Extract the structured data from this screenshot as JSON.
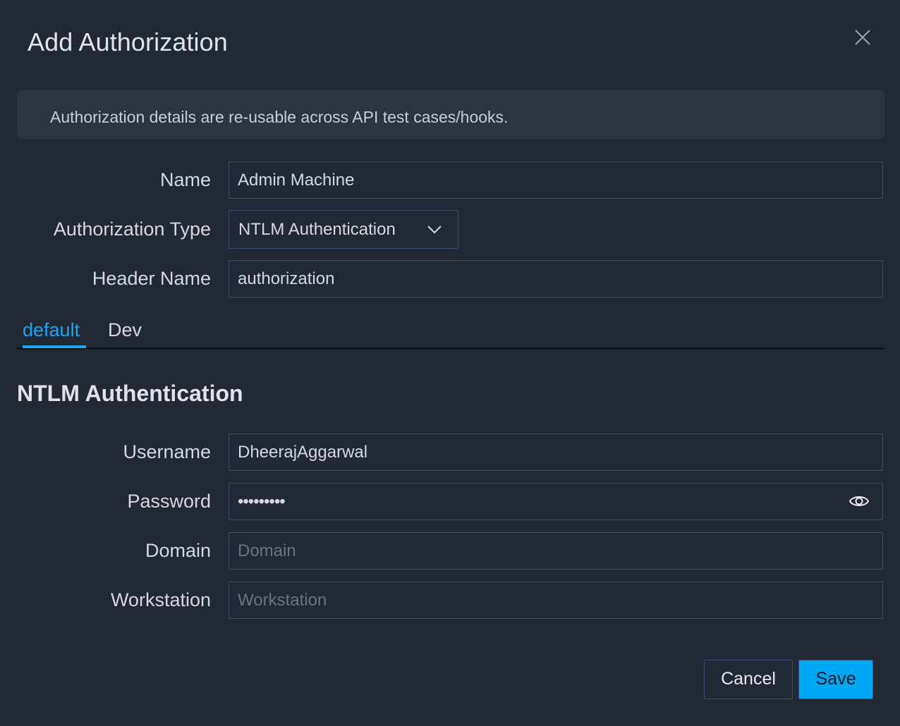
{
  "dialog": {
    "title": "Add Authorization",
    "close_icon": "close-icon"
  },
  "info": {
    "text": "Authorization details are re-usable across API test cases/hooks."
  },
  "form": {
    "name": {
      "label": "Name",
      "value": "Admin Machine"
    },
    "auth_type": {
      "label": "Authorization Type",
      "value": "NTLM Authentication",
      "icon": "chevron-down-icon"
    },
    "header_name": {
      "label": "Header Name",
      "value": "authorization"
    }
  },
  "tabs": [
    {
      "label": "default",
      "active": true
    },
    {
      "label": "Dev",
      "active": false
    }
  ],
  "ntlm": {
    "section_title": "NTLM Authentication",
    "username": {
      "label": "Username",
      "value": "DheerajAggarwal"
    },
    "password": {
      "label": "Password",
      "value": "•••••••••",
      "icon": "eye-icon"
    },
    "domain": {
      "label": "Domain",
      "placeholder": "Domain"
    },
    "workstation": {
      "label": "Workstation",
      "placeholder": "Workstation"
    }
  },
  "buttons": {
    "cancel": "Cancel",
    "save": "Save"
  },
  "colors": {
    "background": "#222834",
    "accent": "#00a8f3",
    "border": "#3d4f6e"
  }
}
